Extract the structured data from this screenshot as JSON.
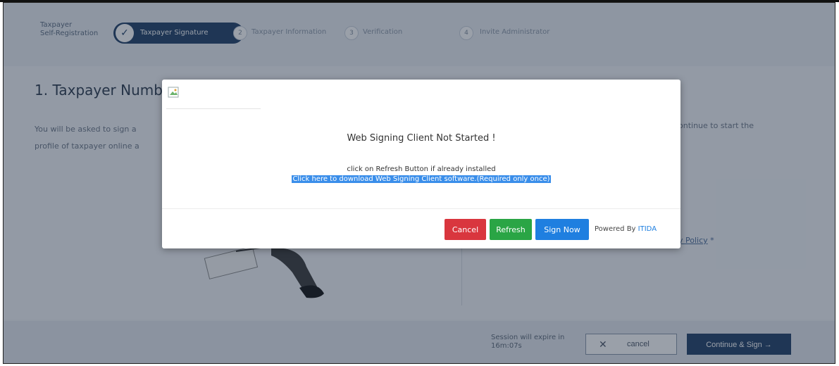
{
  "stepper": {
    "label_line1": "Taxpayer",
    "label_line2": "Self-Registration",
    "steps": [
      {
        "label": "Taxpayer Signature"
      },
      {
        "num": "2",
        "label": "Taxpayer Information"
      },
      {
        "num": "3",
        "label": "Verification"
      },
      {
        "num": "4",
        "label": "Invite Administrator"
      }
    ]
  },
  "main": {
    "title": "1. Taxpayer Numb",
    "para_line1": "You will be asked to sign a",
    "para_line2": "profile of taxpayer online a",
    "para_right": "ontinue to start the",
    "policy_link": "y Policy",
    "policy_star": "*"
  },
  "footer": {
    "session_line1": "Session will expire in",
    "session_line2": "16m:07s",
    "cancel_label": "cancel",
    "continue_label": "Continue & Sign →"
  },
  "modal": {
    "title": "Web Signing Client Not Started !",
    "subtitle": "click on Refresh Button if already installed",
    "download_link": "Click here to download Web Signing Client software.(Required only once)",
    "cancel_label": "Cancel",
    "refresh_label": "Refresh",
    "sign_label": "Sign Now",
    "powered_prefix": "Powered By ",
    "powered_brand": "ITIDA"
  },
  "colors": {
    "primary": "#1f3e66",
    "danger": "#d9363e",
    "success": "#2aa545",
    "info": "#1f7fe0",
    "highlight": "#3a8eea"
  }
}
